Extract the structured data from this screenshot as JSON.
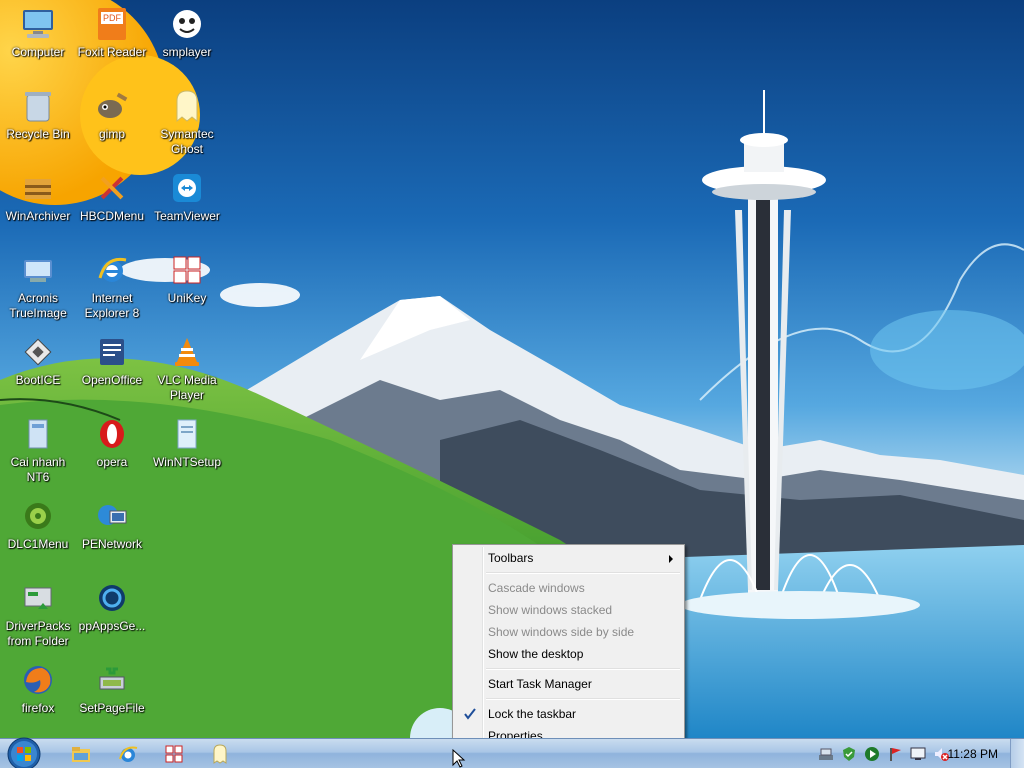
{
  "desktop_icons": [
    {
      "label": "Computer",
      "icon": "computer-icon"
    },
    {
      "label": "Foxit Reader",
      "icon": "pdf-icon"
    },
    {
      "label": "smplayer",
      "icon": "media-player-icon"
    },
    {
      "label": "Recycle Bin",
      "icon": "recycle-bin-icon"
    },
    {
      "label": "gimp",
      "icon": "gimp-icon"
    },
    {
      "label": "Symantec Ghost",
      "icon": "ghost-icon"
    },
    {
      "label": "WinArchiver",
      "icon": "archive-icon"
    },
    {
      "label": "HBCDMenu",
      "icon": "tools-icon"
    },
    {
      "label": "TeamViewer",
      "icon": "teamviewer-icon"
    },
    {
      "label": "Acronis TrueImage",
      "icon": "disk-image-icon"
    },
    {
      "label": "Internet Explorer 8",
      "icon": "internet-explorer-icon"
    },
    {
      "label": "UniKey",
      "icon": "unikey-icon"
    },
    {
      "label": "BootICE",
      "icon": "bootice-icon"
    },
    {
      "label": "OpenOffice",
      "icon": "openoffice-icon"
    },
    {
      "label": "VLC Media Player",
      "icon": "vlc-icon"
    },
    {
      "label": "Cai nhanh NT6",
      "icon": "installer-icon"
    },
    {
      "label": "opera",
      "icon": "opera-icon"
    },
    {
      "label": "WinNTSetup",
      "icon": "setup-icon"
    },
    {
      "label": "DLC1Menu",
      "icon": "dlc-icon"
    },
    {
      "label": "PENetwork",
      "icon": "network-icon"
    },
    {
      "label": "DriverPacks from Folder",
      "icon": "driver-icon"
    },
    {
      "label": "ppAppsGe...",
      "icon": "apps-icon"
    },
    {
      "label": "firefox",
      "icon": "firefox-icon"
    },
    {
      "label": "SetPageFile",
      "icon": "pagefile-icon"
    }
  ],
  "context_menu": {
    "toolbars": "Toolbars",
    "cascade": "Cascade windows",
    "stacked": "Show windows stacked",
    "side_by_side": "Show windows side by side",
    "show_desktop": "Show the desktop",
    "task_manager": "Start Task Manager",
    "lock": "Lock the taskbar",
    "lock_checked": true,
    "properties": "Properties"
  },
  "taskbar": {
    "pinned": [
      "explorer-icon",
      "internet-explorer-icon",
      "unikey-icon",
      "ghost-icon"
    ],
    "tray_icons": [
      "network-icon",
      "security-icon",
      "media-play-icon",
      "flag-icon",
      "display-icon",
      "volume-muted-icon"
    ],
    "clock": "11:28 PM"
  },
  "colors": {
    "menu_bg": "#f0f0f0",
    "taskbar": "#a9c6e6",
    "accent": "#2a7fc8"
  }
}
